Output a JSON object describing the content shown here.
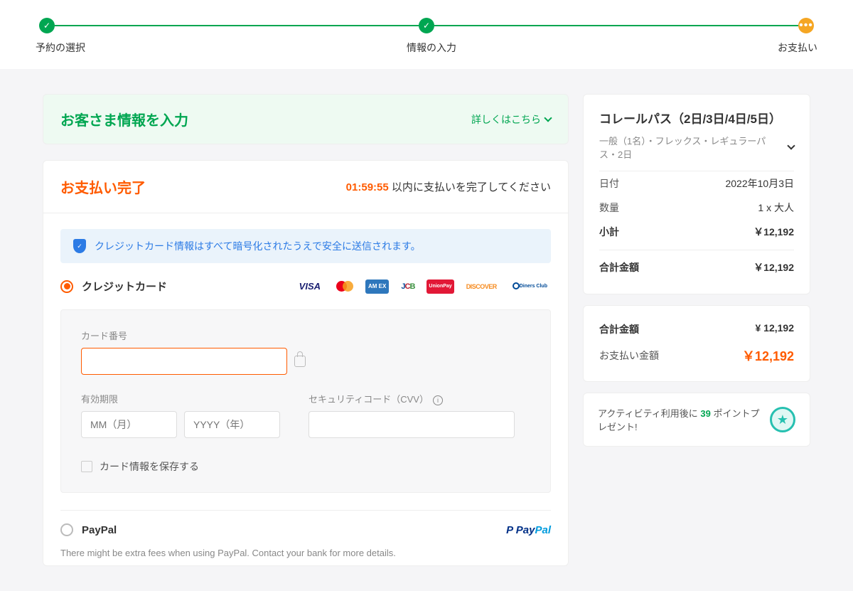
{
  "progress": {
    "step1": "予約の選択",
    "step2": "情報の入力",
    "step3": "お支払い"
  },
  "info_panel": {
    "title": "お客さま情報を入力",
    "link": "詳しくはこちら"
  },
  "payment": {
    "title": "お支払い完了",
    "timer": "01:59:55",
    "timer_suffix": " 以内に支払いを完了してください",
    "security_msg": "クレジットカード情報はすべて暗号化されたうえで安全に送信されます。",
    "cc_label": "クレジットカード",
    "card_no_label": "カード番号",
    "expiry_label": "有効期限",
    "mm_ph": "MM（月）",
    "yyyy_ph": "YYYY（年）",
    "cvv_label": "セキュリティコード（CVV）",
    "save_card": "カード情報を保存する",
    "paypal_label": "PayPal",
    "paypal_note": "There might be extra fees when using PayPal. Contact your bank for more details."
  },
  "brands": {
    "visa": "VISA",
    "amex": "AM EX",
    "jcb": "JCB",
    "up": "UnionPay",
    "disc": "DISCOVER",
    "diners": "Diners Club"
  },
  "summary": {
    "product": "コレールパス（2日/3日/4日/5日）",
    "variant": "一般（1名）・フレックス・レギュラーパス・2日",
    "date_label": "日付",
    "date": "2022年10月3日",
    "qty_label": "数量",
    "qty": "1 x 大人",
    "subtotal_label": "小計",
    "subtotal": "￥12,192",
    "total_label": "合計金額",
    "total": "￥12,192"
  },
  "totals": {
    "total_label": "合計金額",
    "total": "¥ 12,192",
    "pay_label": "お支払い金額",
    "pay": "￥12,192"
  },
  "points": {
    "prefix": "アクティビティ利用後に ",
    "value": "39",
    "suffix": " ポイントプレゼント!"
  }
}
